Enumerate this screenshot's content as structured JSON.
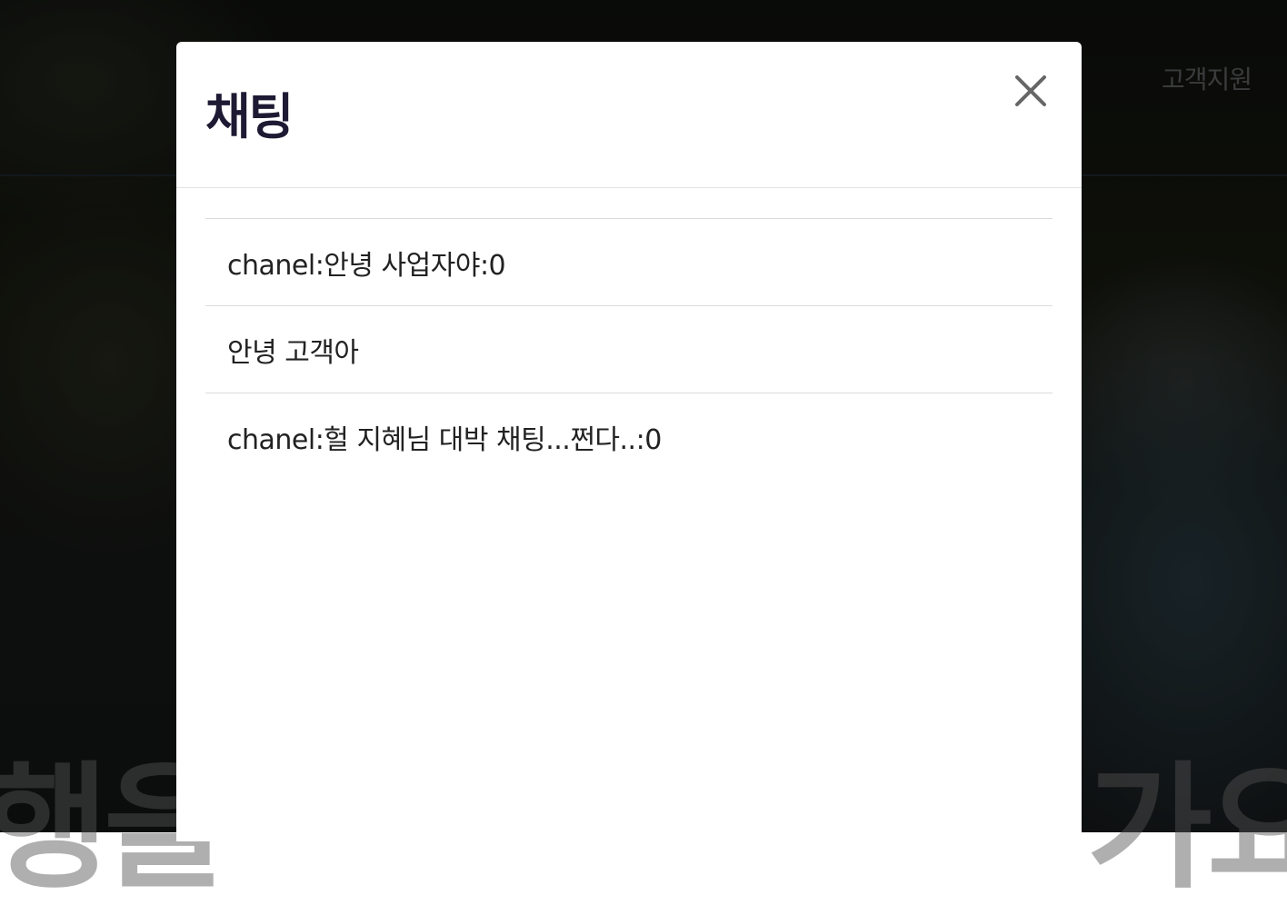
{
  "background": {
    "support_link": "고객지원",
    "hero_text_left": "행을",
    "hero_text_right": "가요"
  },
  "modal": {
    "title": "채팅",
    "close_icon": "close-icon",
    "messages": [
      "chanel:안녕 사업자야:0",
      "안녕 고객아",
      "chanel:헐 지혜님 대박 채팅...쩐다..:0"
    ]
  },
  "colors": {
    "title": "#1e1a33",
    "text": "#222222",
    "divider": "#dcdcdc",
    "close_icon": "#666666",
    "modal_bg": "#ffffff"
  }
}
